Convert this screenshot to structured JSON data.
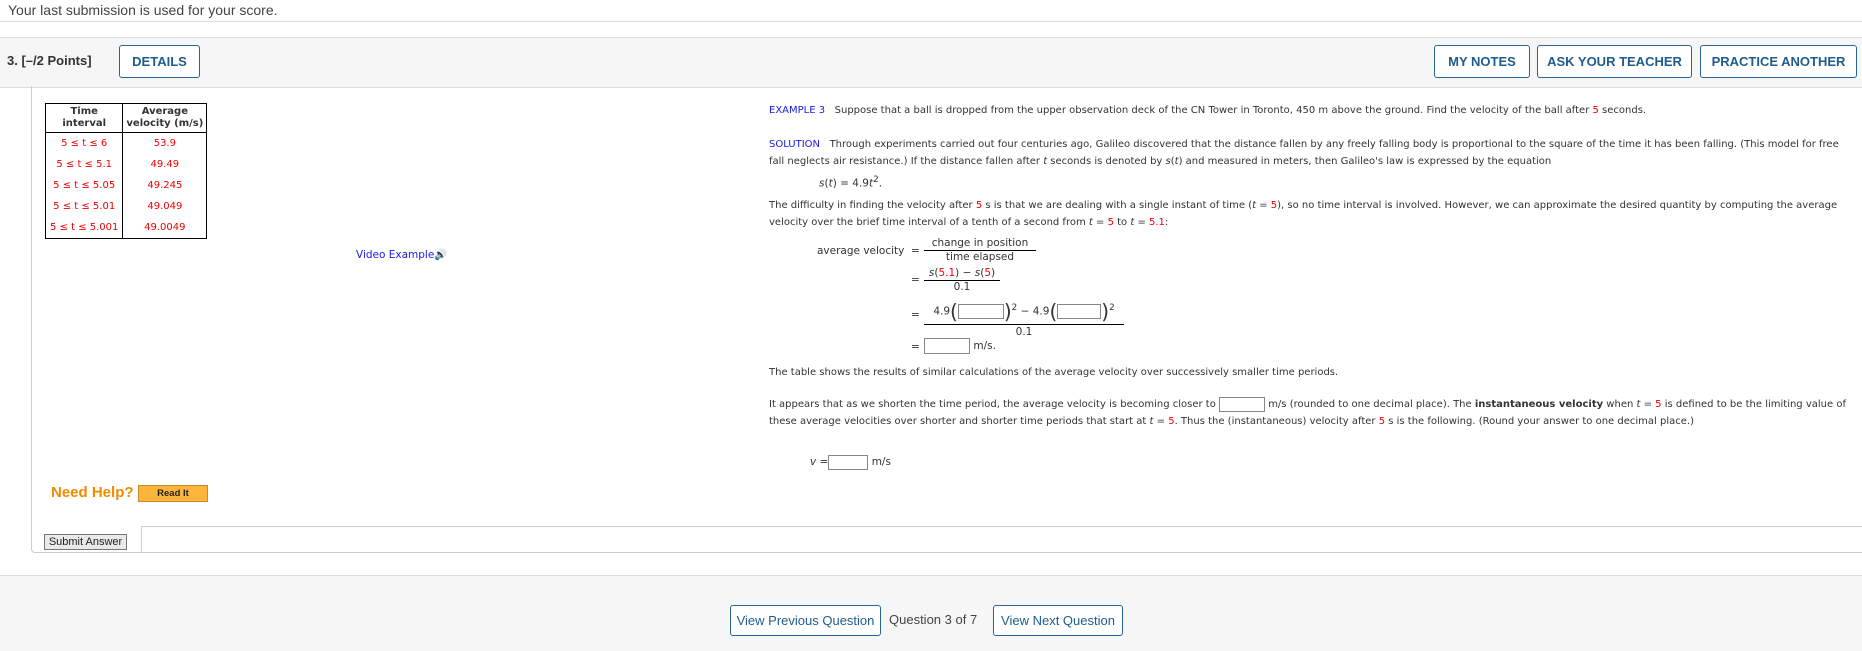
{
  "top_note": "Your last submission is used for your score.",
  "question": {
    "number": "3.",
    "points": "[–/2 Points]",
    "details_label": "DETAILS",
    "my_notes_label": "MY NOTES",
    "ask_teacher_label": "ASK YOUR TEACHER",
    "practice_another_label": "PRACTICE ANOTHER"
  },
  "table": {
    "headers": [
      [
        "Time",
        "interval"
      ],
      [
        "Average",
        "velocity (m/s)"
      ]
    ],
    "rows": [
      {
        "interval": "5 ≤ t ≤ 6",
        "velocity": "53.9"
      },
      {
        "interval": "5 ≤ t ≤ 5.1",
        "velocity": "49.49"
      },
      {
        "interval": "5 ≤ t ≤ 5.05",
        "velocity": "49.245"
      },
      {
        "interval": "5 ≤ t ≤ 5.01",
        "velocity": "49.049"
      },
      {
        "interval": "5 ≤ t ≤ 5.001",
        "velocity": "49.0049"
      }
    ]
  },
  "video_example": "Video Example",
  "example": {
    "label": "EXAMPLE 3",
    "text": [
      {
        "t": "   Suppose that a ball is dropped from the upper observation deck of the CN Tower in Toronto, 450 m above the ground. Find the velocity of the ball after "
      },
      {
        "t": "5",
        "s": "red"
      },
      {
        "t": " seconds."
      }
    ]
  },
  "solution": {
    "label": "SOLUTION",
    "text": [
      {
        "t": "   Through experiments carried out four centuries ago, Galileo discovered that the distance fallen by any freely falling body is proportional to the square of the time it has been falling. (This model for free fall neglects air resistance.) If the distance fallen after "
      },
      {
        "t": "t",
        "s": "it"
      },
      {
        "t": " seconds is denoted by "
      },
      {
        "t": "s",
        "s": "it"
      },
      {
        "t": "("
      },
      {
        "t": "t",
        "s": "it"
      },
      {
        "t": ") and measured in meters, then Galileo's law is expressed by the equation"
      }
    ],
    "equation": [
      {
        "t": "s",
        "s": "it"
      },
      {
        "t": "("
      },
      {
        "t": "t",
        "s": "it"
      },
      {
        "t": ") = 4.9"
      },
      {
        "t": "t",
        "s": "it"
      },
      {
        "t": "2",
        "s": "sup"
      },
      {
        "t": "."
      }
    ]
  },
  "difficulty": [
    {
      "t": "The difficulty in finding the velocity after "
    },
    {
      "t": "5",
      "s": "red"
    },
    {
      "t": " s is that we are dealing with a single instant of time ("
    },
    {
      "t": "t",
      "s": "it"
    },
    {
      "t": " = "
    },
    {
      "t": "5",
      "s": "red"
    },
    {
      "t": "), so no time interval is involved. However, we can approximate the desired quantity by computing the average velocity over the brief time interval of a tenth of a second from "
    },
    {
      "t": "t",
      "s": "it"
    },
    {
      "t": " = "
    },
    {
      "t": "5",
      "s": "red"
    },
    {
      "t": " to "
    },
    {
      "t": "t",
      "s": "it"
    },
    {
      "t": " = "
    },
    {
      "t": "5.1",
      "s": "red"
    },
    {
      "t": ":"
    }
  ],
  "math": {
    "lhs": "average velocity",
    "eq": "=",
    "num1": "change in position",
    "den1": "time elapsed",
    "num2": [
      {
        "t": "s",
        "s": "it"
      },
      {
        "t": "("
      },
      {
        "t": "5.1",
        "s": "red"
      },
      {
        "t": ") − "
      },
      {
        "t": "s",
        "s": "it"
      },
      {
        "t": "("
      },
      {
        "t": "5",
        "s": "red"
      },
      {
        "t": ")"
      }
    ],
    "den2": "0.1",
    "coef": "4.9",
    "minus": "− 4.9",
    "exp": "2",
    "den3": "0.1",
    "unit": "m/s.",
    "field1_value": "",
    "field2_value": "",
    "field3_value": ""
  },
  "table_text": "The table shows the results of similar calculations of the average velocity over successively smaller time periods.",
  "appears": {
    "before": "It appears that as we shorten the time period, the average velocity is becoming closer to ",
    "field_value": "",
    "after": [
      {
        "t": " m/s (rounded to one decimal place). The "
      },
      {
        "t": "instantaneous velocity",
        "s": "b"
      },
      {
        "t": " when "
      },
      {
        "t": "t",
        "s": "it"
      },
      {
        "t": " = "
      },
      {
        "t": "5",
        "s": "red"
      },
      {
        "t": " is defined to be the limiting value of these average velocities over shorter and shorter time periods that start at "
      },
      {
        "t": "t",
        "s": "it"
      },
      {
        "t": " = "
      },
      {
        "t": "5",
        "s": "red"
      },
      {
        "t": ". Thus the (instantaneous) velocity after "
      },
      {
        "t": "5",
        "s": "red"
      },
      {
        "t": " s is the following. (Round your answer to one decimal place.)"
      }
    ]
  },
  "answer": {
    "label": "v =",
    "value": "",
    "unit": "m/s"
  },
  "help": {
    "label": "Need Help?",
    "read_it": "Read It"
  },
  "submit_label": "Submit Answer",
  "footer": {
    "prev_label": "View Previous Question",
    "position": "Question 3 of 7",
    "next_label": "View Next Question"
  },
  "colors": {
    "accent": "#1f5c8b",
    "highlight_red": "#e00000",
    "example_blue": "#1a1ae6",
    "help_orange": "#f08a00"
  }
}
